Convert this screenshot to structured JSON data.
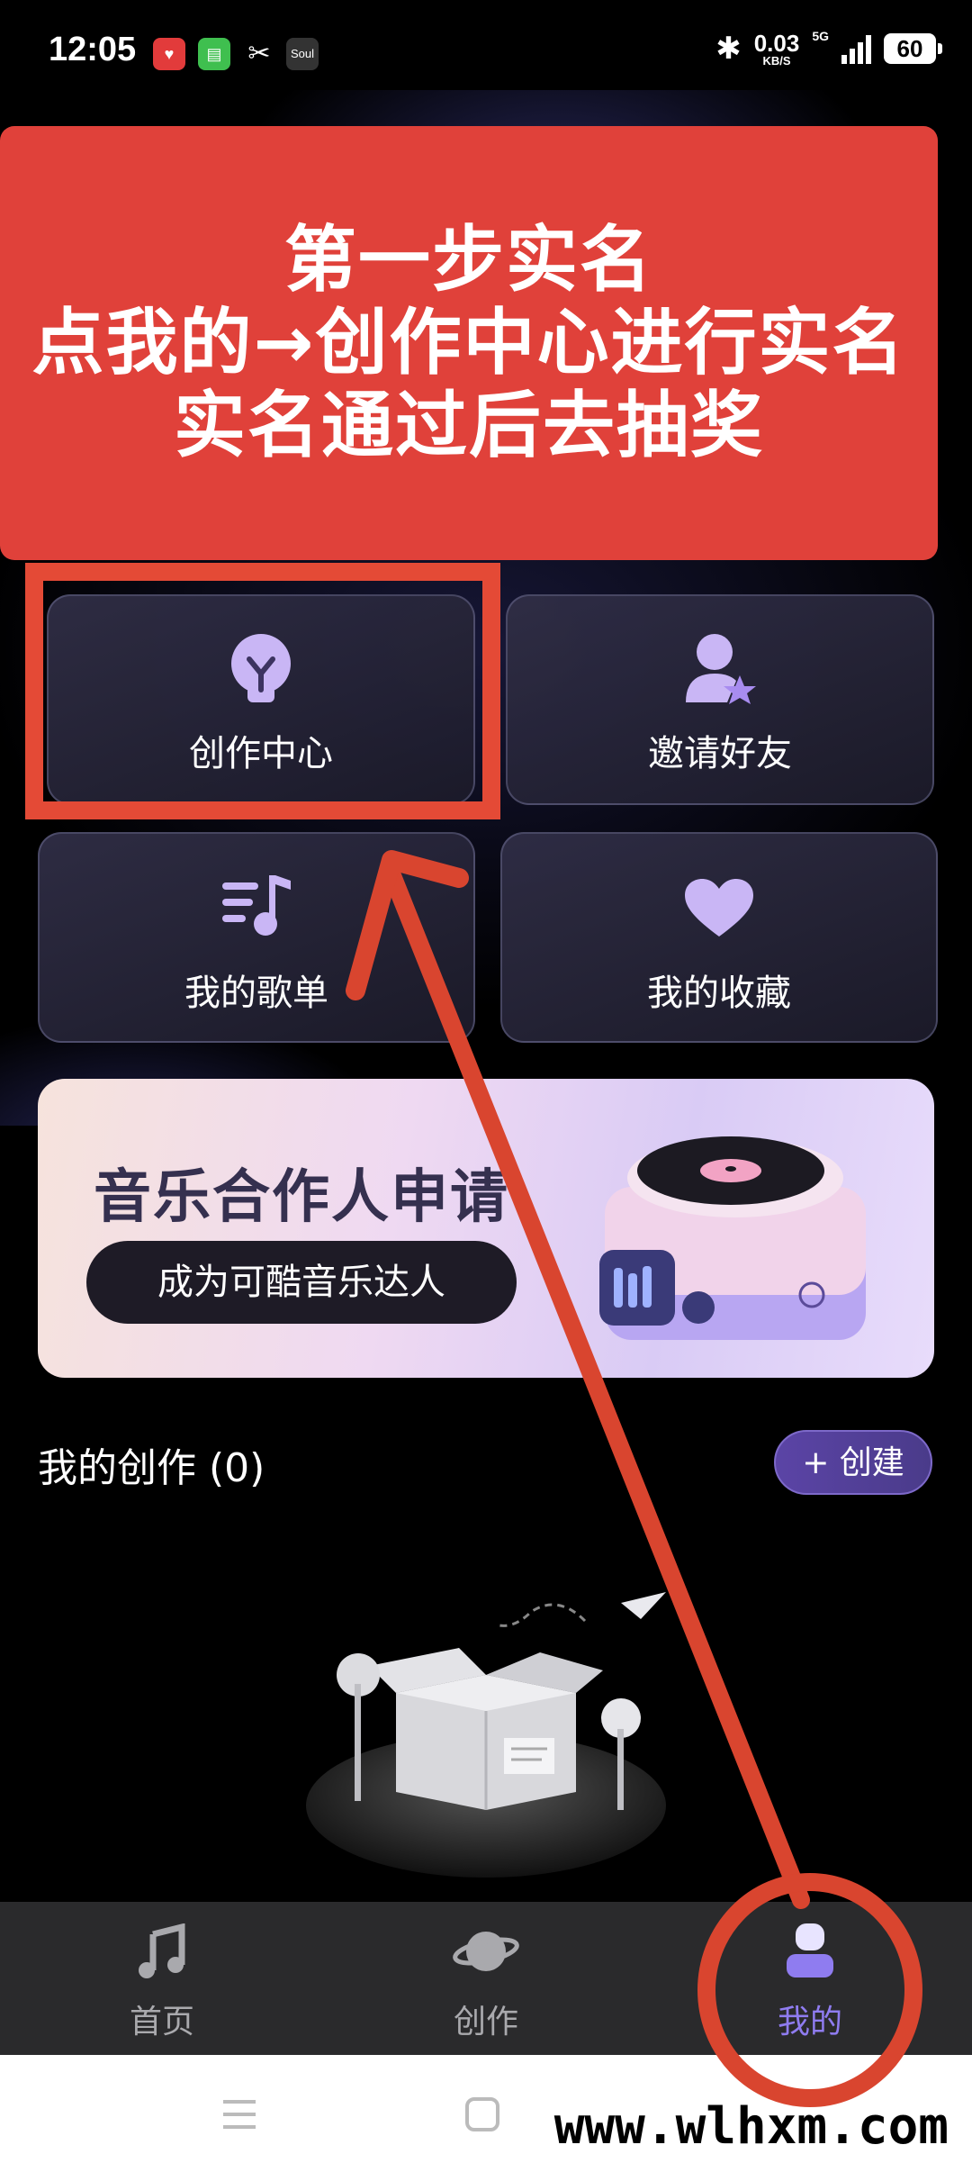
{
  "status_bar": {
    "time": "12:05",
    "net_speed_value": "0.03",
    "net_speed_unit": "KB/S",
    "network": "5G",
    "battery": "60",
    "notification_apps": [
      "heart-app-icon",
      "chat-app-icon",
      "capcut-app-icon",
      "soul-app-icon"
    ],
    "soul_label": "Soul"
  },
  "annotation": {
    "lines": [
      "第一步实名",
      "点我的→创作中心进行实名",
      "实名通过后去抽奖"
    ],
    "color": "#e0413a"
  },
  "menu": {
    "creation_center": "创作中心",
    "invite_friends": "邀请好友",
    "my_playlist": "我的歌单",
    "my_favorites": "我的收藏"
  },
  "promo": {
    "title": "音乐合作人申请",
    "button": "成为可酷音乐达人"
  },
  "my_works": {
    "title": "我的创作 (0)",
    "create_button": "+ 创建"
  },
  "bottom_nav": {
    "items": [
      {
        "label": "首页",
        "icon": "music-note-icon"
      },
      {
        "label": "创作",
        "icon": "planet-icon"
      },
      {
        "label": "我的",
        "icon": "profile-icon",
        "active": true
      }
    ],
    "active_color": "#8f7cf0"
  },
  "watermark": "www.wlhxm.com"
}
